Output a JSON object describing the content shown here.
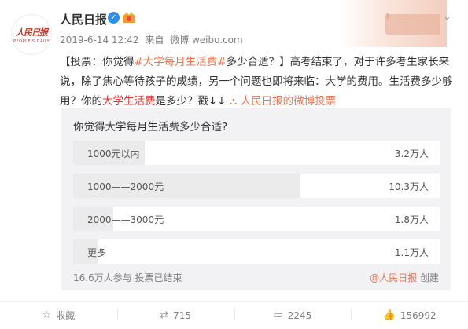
{
  "header": {
    "author": "人民日报",
    "avatar_text": "人民日报",
    "avatar_sub": "PEOPLE'S DAILY",
    "date": "2019-6-14 12:42",
    "source_prefix": "来自",
    "source": "微博 weibo.com"
  },
  "post": {
    "seg1": "【投票：你觉得",
    "seg2": "#大学每月生活费#",
    "seg3": "多少合适？】高考结束了，对于许多考生家长来说，除了焦心等待孩子的成绩，另一个问题也即将来临：大学的费用。生活费多少够用？你的",
    "seg4": "大学生活费",
    "seg5": "是多少？戳↓↓",
    "link": "人民日报的微博投票"
  },
  "poll": {
    "question": "你觉得大学每月生活费多少合适?",
    "options": [
      {
        "label": "1000元以内",
        "count": "3.2万人",
        "share": 0.195
      },
      {
        "label": "1000——2000元",
        "count": "10.3万人",
        "share": 0.62
      },
      {
        "label": "2000——3000元",
        "count": "1.8万人",
        "share": 0.11
      },
      {
        "label": "更多",
        "count": "1.1万人",
        "share": 0.066
      }
    ],
    "footer": "16.6万人参与  投票已结束",
    "creator_at": "@人民日报",
    "creator_suffix": " 创建"
  },
  "actions": {
    "favorite": "收藏",
    "repost": "715",
    "comment": "2245",
    "like": "156992"
  },
  "icons": {
    "verified": "verified-badge-icon",
    "vip": "vip-crown-icon",
    "more": "chevron-down-icon",
    "link": "poll-link-icon",
    "favorite": "star-icon",
    "repost": "repost-icon",
    "comment": "comment-icon",
    "like": "thumb-up-icon"
  },
  "colors": {
    "accent": "#eb7350",
    "hashtag_red": "#e5312f",
    "verified": "#2f8fe6"
  }
}
